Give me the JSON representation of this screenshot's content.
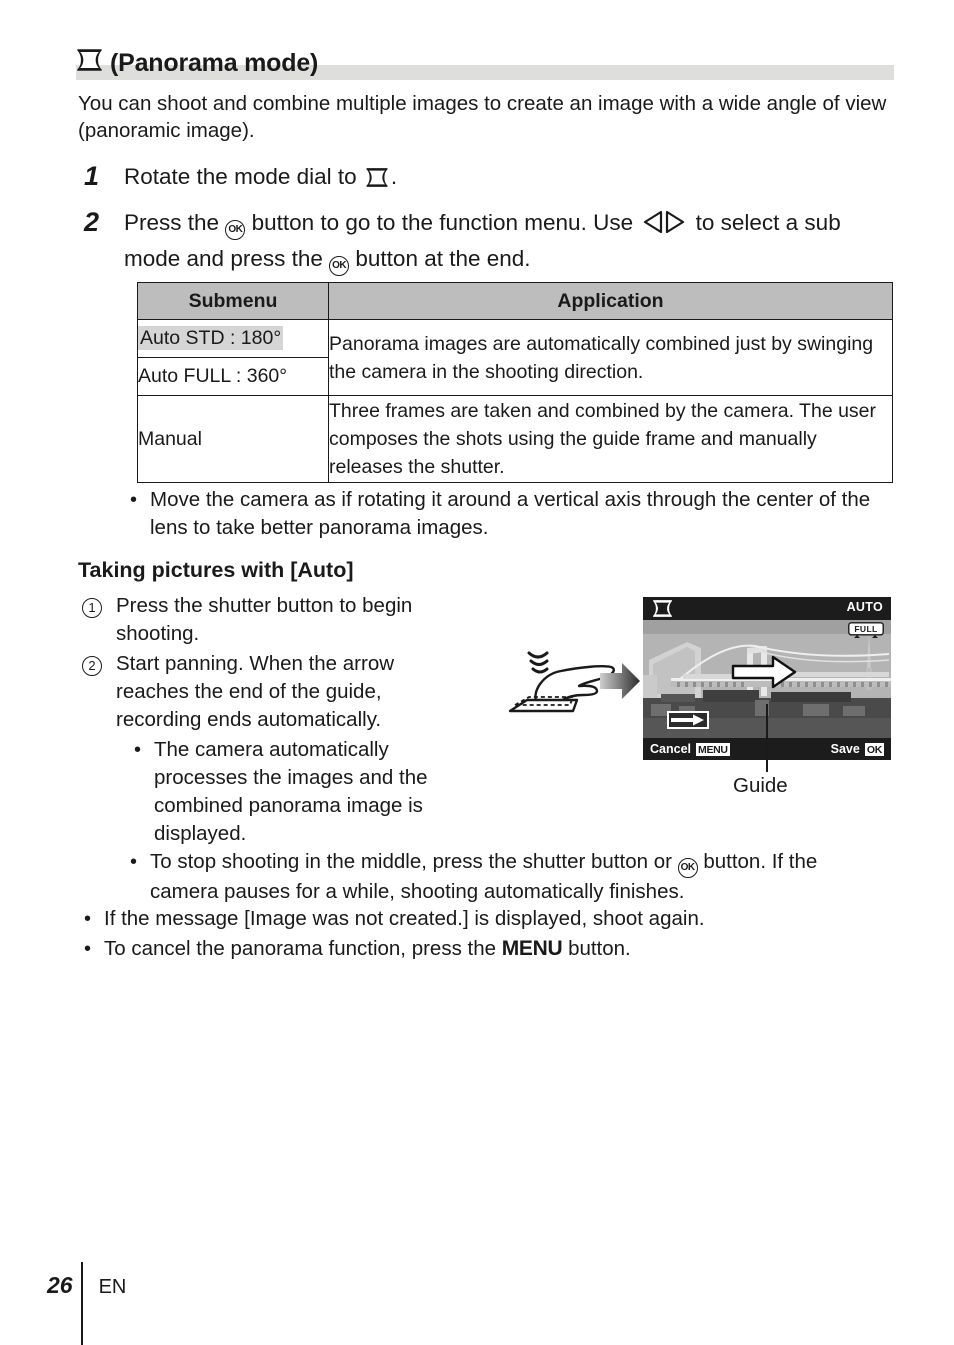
{
  "page": {
    "number": "26",
    "language": "EN"
  },
  "title": {
    "icon": "panorama-mode-icon",
    "text": "(Panorama mode)"
  },
  "intro": "You can shoot and combine multiple images to create an image with a wide angle of view (panoramic image).",
  "steps": [
    {
      "number": "1",
      "text_before": "Rotate the mode dial to",
      "icon": "panorama-mode-icon",
      "text_after": "."
    },
    {
      "number": "2",
      "part1": "Press the",
      "ok_label": "OK",
      "part2": "button to go to the function menu. Use",
      "arrows_icon": "left-right-arrows-icon",
      "part3": "to select a sub mode and press the",
      "part4": "button at the end."
    }
  ],
  "table": {
    "headers": [
      "Submenu",
      "Application"
    ],
    "rows": [
      {
        "submenu": "Auto STD : 180°",
        "highlighted": true,
        "application": "Panorama images are automatically combined just by swinging the camera in the shooting direction."
      },
      {
        "submenu": "Auto FULL : 360°",
        "highlighted": false
      },
      {
        "submenu": "Manual",
        "highlighted": false,
        "application": "Three frames are taken and combined by the camera. The user composes the shots using the guide frame and manually releases the shutter."
      }
    ]
  },
  "note_move": "Move the camera as if rotating it around a vertical axis through the center of the lens to take better panorama images.",
  "section_heading": "Taking pictures with [Auto]",
  "circled_steps": [
    {
      "number": "1",
      "text": "Press the shutter button to begin shooting."
    },
    {
      "number": "2",
      "text": "Start panning. When the arrow reaches the end of the guide, recording ends automatically.",
      "sub_bullets": [
        "The camera automatically processes the images and the combined panorama image is displayed."
      ]
    }
  ],
  "note_stop": {
    "part1": "To stop shooting in the middle, press the shutter button or",
    "ok_label": "OK",
    "part2": "button. If the camera pauses for a while, shooting automatically finishes."
  },
  "note_msg": "If the message [Image was not created.] is displayed, shoot again.",
  "note_cancel": {
    "part1": "To cancel the panorama function, press the",
    "menu_label": "MENU",
    "part2": "button."
  },
  "camera_screen": {
    "mode_icon": "panorama-mode-icon",
    "mode_label": "AUTO",
    "sub_mode_badge": "FULL",
    "cancel_label": "Cancel",
    "cancel_key": "MENU",
    "save_label": "Save",
    "save_key": "OK",
    "pan_arrow_icon": "pan-direction-arrow-icon",
    "guide_icon": "guide-arrow-icon"
  },
  "guide_callout": "Guide",
  "illustration": {
    "hand_icon": "hand-pressing-shutter-icon",
    "flow_arrow_icon": "flow-arrow-icon"
  },
  "colors": {
    "title_band": "#dededd",
    "table_header": "#bdbdbd",
    "highlight": "#d5d5d5",
    "text": "#1a1a1a"
  }
}
